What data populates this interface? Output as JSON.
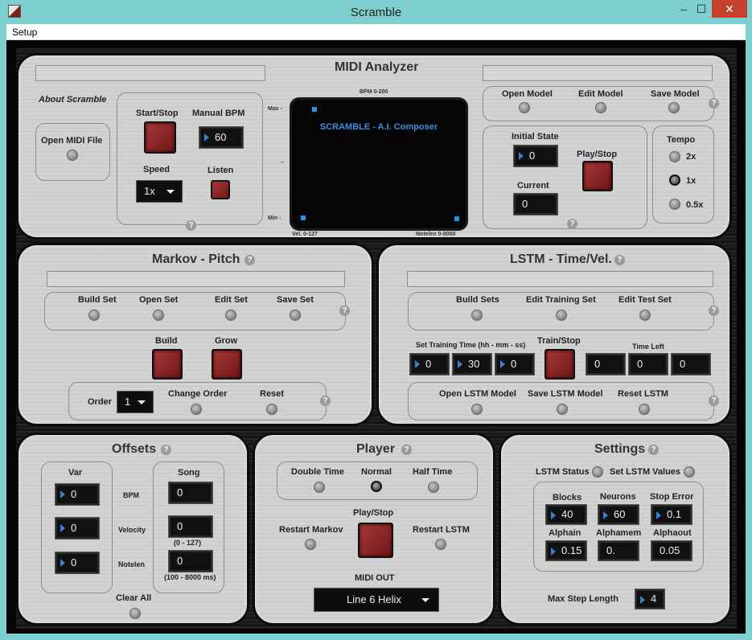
{
  "window": {
    "title": "Scramble",
    "minimize": "–",
    "maximize": "☐",
    "close": "✕"
  },
  "menu": {
    "setup": "Setup"
  },
  "analyzer": {
    "title": "MIDI Analyzer",
    "about": "About Scramble",
    "open_midi": "Open MIDI File",
    "start_stop": "Start/Stop",
    "manual_bpm": "Manual BPM",
    "bpm_value": "60",
    "speed": "Speed",
    "speed_value": "1x",
    "listen": "Listen",
    "scope": {
      "bpm_range": "BPM 0-200",
      "title": "SCRAMBLE - A.I. Composer",
      "max": "Max -",
      "mid": "–",
      "min": "Min -",
      "vel": "Vel. 0-127",
      "notelen": "Notelen 0-8000"
    },
    "open_model": "Open Model",
    "edit_model": "Edit Model",
    "save_model": "Save Model",
    "initial_state": "Initial State",
    "initial_value": "0",
    "current": "Current",
    "current_value": "0",
    "play_stop": "Play/Stop",
    "tempo": "Tempo",
    "tempo_options": [
      "2x",
      "1x",
      "0.5x"
    ]
  },
  "markov": {
    "title": "Markov - Pitch",
    "build_set": "Build Set",
    "open_set": "Open Set",
    "edit_set": "Edit Set",
    "save_set": "Save Set",
    "build": "Build",
    "grow": "Grow",
    "order": "Order",
    "order_value": "1",
    "change_order": "Change Order",
    "reset": "Reset"
  },
  "lstm": {
    "title": "LSTM - Time/Vel.",
    "build_sets": "Build Sets",
    "edit_training": "Edit Training Set",
    "edit_test": "Edit Test Set",
    "training_time": "Set Training Time (hh - mm - ss)",
    "hh": "0",
    "mm": "30",
    "ss": "0",
    "train_stop": "Train/Stop",
    "time_left": "Time Left",
    "left_hh": "0",
    "left_mm": "0",
    "left_ss": "0",
    "open_lstm": "Open LSTM Model",
    "save_lstm": "Save LSTM Model",
    "reset_lstm": "Reset LSTM"
  },
  "offsets": {
    "title": "Offsets",
    "var": "Var",
    "song": "Song",
    "bpm": "BPM",
    "velocity": "Velocity",
    "notelen": "Notelen",
    "var_bpm": "0",
    "var_vel": "0",
    "var_len": "0",
    "song_bpm": "0",
    "song_vel": "0",
    "song_len": "0",
    "vel_range": "(0 - 127)",
    "len_range": "(100 - 8000 ms)",
    "clear_all": "Clear All"
  },
  "player": {
    "title": "Player",
    "double_time": "Double Time",
    "normal": "Normal",
    "half_time": "Half Time",
    "restart_markov": "Restart Markov",
    "play_stop": "Play/Stop",
    "restart_lstm": "Restart LSTM",
    "midi_out": "MIDI OUT",
    "midi_device": "Line 6 Helix"
  },
  "settings": {
    "title": "Settings",
    "lstm_status": "LSTM Status",
    "set_lstm_values": "Set LSTM Values",
    "blocks": "Blocks",
    "blocks_value": "40",
    "neurons": "Neurons",
    "neurons_value": "60",
    "stop_error": "Stop Error",
    "stop_error_value": "0.1",
    "alphain": "Alphain",
    "alphain_value": "0.15",
    "alphamem": "Alphamem",
    "alphamem_value": "0.",
    "alphaout": "Alphaout",
    "alphaout_value": "0.05",
    "max_step": "Max Step Length",
    "max_step_value": "4"
  },
  "help": "?"
}
